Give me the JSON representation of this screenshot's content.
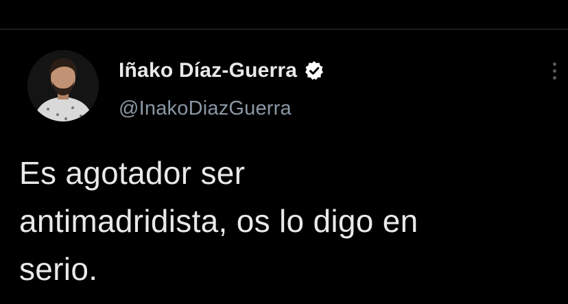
{
  "tweet": {
    "author": {
      "display_name": "Iñako Díaz-Guerra",
      "handle": "@InakoDiazGuerra",
      "verified": true
    },
    "text": "Es agotador ser\nantimadridista, os lo digo en\nserio."
  },
  "colors": {
    "background": "#000000",
    "primary_text": "#e7e9ea",
    "secondary_text": "#8b98a5",
    "verified_badge": "#ffffff",
    "divider": "#2f3336"
  },
  "icons": {
    "verified": "verified-badge-icon",
    "more": "more-options-icon"
  }
}
